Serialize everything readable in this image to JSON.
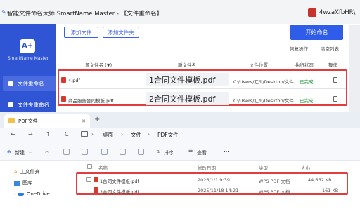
{
  "app": {
    "title": "智能文件命名大师 SmartName Master - 【文件重命名】",
    "user_name": "4wzaXfbHR\\",
    "logo_letters": "A+",
    "logo_text": "SmartName Master"
  },
  "sidebar": {
    "items": [
      {
        "label": "文件重命名"
      },
      {
        "label": "文件夹重命名"
      }
    ]
  },
  "toolbar": {
    "add_file": "添加文件",
    "add_folder": "添加文件夹",
    "start_rename": "开始命名",
    "restore": "恢复操作",
    "clear_list": "清空列表"
  },
  "table": {
    "headers": [
      "源文件名 (▼)",
      "新文件名",
      "文件位置",
      "执行状态",
      "操作"
    ],
    "rows": [
      {
        "source": "4.pdf",
        "new_name": "1合同文件模板.pdf",
        "location": "C:/Users/汇/ll/Desktop/文件",
        "status": "已完成"
      },
      {
        "source": "商品服务合同模板.pdf",
        "new_name": "2合同文件模板.pdf",
        "location": "C:/Users/汇/ll/Desktop/文件",
        "status": "已完成"
      }
    ]
  },
  "explorer": {
    "tab_title": "PDF文件",
    "new_tab": "+",
    "nav": {
      "back": "←",
      "forward": "→",
      "up": "↑",
      "refresh": "C"
    },
    "breadcrumb": [
      "桌面",
      "文件",
      "PDF文件"
    ],
    "toolbar": {
      "new": "新建",
      "sort": "排序",
      "view": "查看",
      "more": "···"
    },
    "left_nav": [
      "主文件夹",
      "图库",
      "OneDrive"
    ],
    "headers": [
      "名称",
      "修改日期",
      "类型",
      "大小"
    ],
    "files": [
      {
        "name": "1合同文件模板.pdf",
        "date": "2026/1/1 9:39",
        "type": "WPS PDF 文档",
        "size": "44,662 KB"
      },
      {
        "name": "2合同文件模板.pdf",
        "date": "2025/11/18 14:21",
        "type": "WPS PDF 文档",
        "size": "161 KB"
      }
    ]
  },
  "colors": {
    "brand": "#2f55d4",
    "primary_button": "#2f5ce8",
    "status_done": "#1f9a3b",
    "highlight": "#e03e3e"
  }
}
